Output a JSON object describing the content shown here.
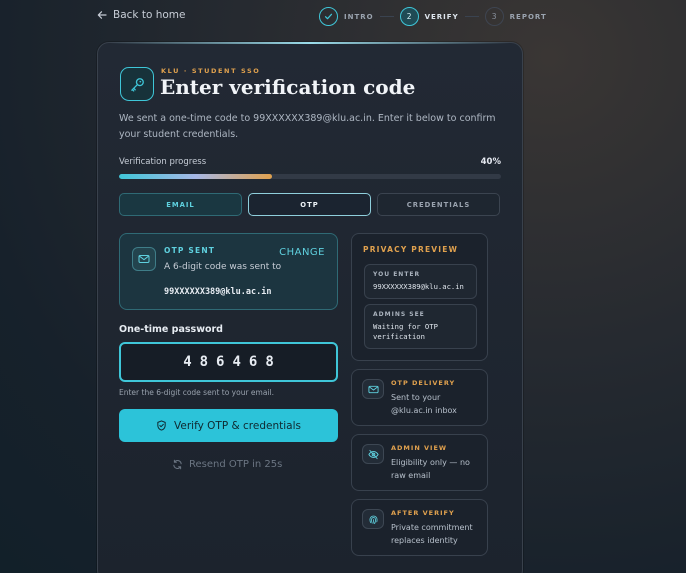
{
  "nav": {
    "back_label": "Back to home"
  },
  "steps": [
    {
      "number": "",
      "label": "INTRO",
      "state": "done",
      "icon": "check-icon"
    },
    {
      "number": "2",
      "label": "VERIFY",
      "state": "active"
    },
    {
      "number": "3",
      "label": "REPORT",
      "state": "todo"
    }
  ],
  "header": {
    "icon": "key-icon",
    "eyebrow": "KLU · STUDENT SSO",
    "title": "Enter verification code",
    "description": "We sent a one-time code to 99XXXXXX389@klu.ac.in. Enter it below to confirm your student credentials."
  },
  "progress": {
    "label": "Verification progress",
    "value_text": "40%",
    "fraction": 0.4
  },
  "tabs": [
    {
      "label": "EMAIL",
      "state": "complete"
    },
    {
      "label": "OTP",
      "state": "active"
    },
    {
      "label": "CREDENTIALS",
      "state": "pending"
    }
  ],
  "otp_sent": {
    "icon": "mail-icon",
    "title": "OTP SENT",
    "change_label": "CHANGE",
    "text": "A 6-digit code was sent to",
    "email": "99XXXXXX389@klu.ac.in"
  },
  "otp": {
    "label": "One-time password",
    "value": "486468",
    "hint": "Enter the 6-digit code sent to your email."
  },
  "verify_button": {
    "label": "Verify OTP & credentials",
    "icon": "shield-icon"
  },
  "resend": {
    "label": "Resend OTP in 25s",
    "icon": "refresh-icon"
  },
  "privacy": {
    "title": "PRIVACY PREVIEW",
    "you_enter": {
      "key": "YOU ENTER",
      "value": "99XXXXXX389@klu.ac.in"
    },
    "admins_see": {
      "key": "ADMINS SEE",
      "value": "Waiting for OTP verification"
    }
  },
  "info_cards": [
    {
      "icon": "mail-icon",
      "title": "OTP DELIVERY",
      "text": "Sent to your @klu.ac.in inbox"
    },
    {
      "icon": "eye-off-icon",
      "title": "ADMIN VIEW",
      "text": "Eligibility only — no raw email"
    },
    {
      "icon": "fingerprint-icon",
      "title": "AFTER VERIFY",
      "text": "Private commitment replaces identity"
    }
  ],
  "colors": {
    "accent": "#2cc3d9",
    "warm": "#e0a14e",
    "card": "#1c232d"
  }
}
